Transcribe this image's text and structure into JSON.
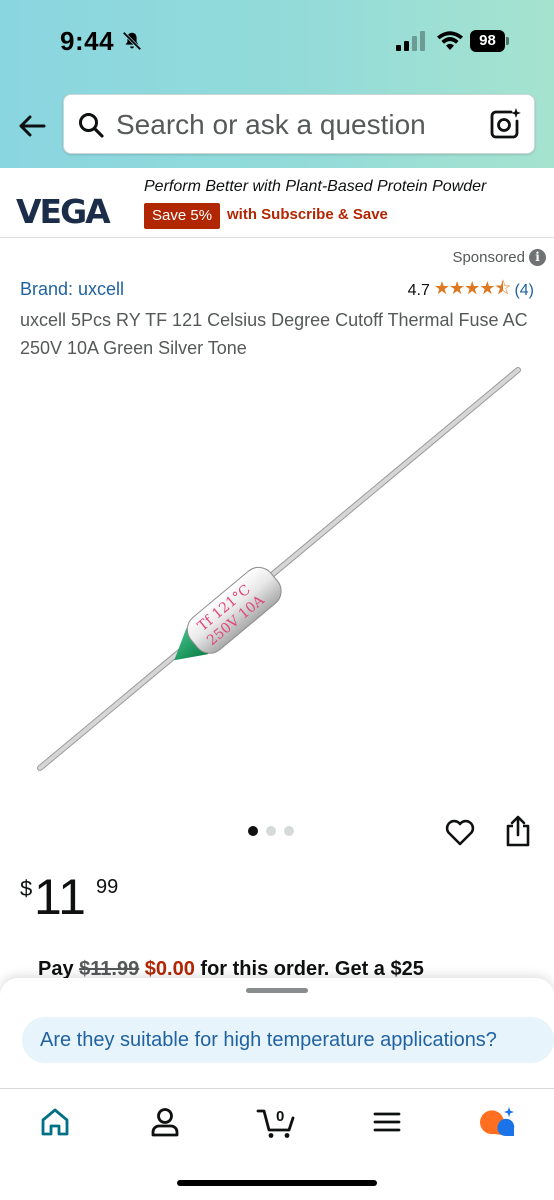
{
  "status_bar": {
    "time": "9:44",
    "battery": "98"
  },
  "header": {
    "search_placeholder": "Search or ask a question",
    "colors": {
      "gradient_start": "#8ad6e0",
      "gradient_end": "#a6e3cf"
    }
  },
  "ad": {
    "logo": "VEGA",
    "headline": "Perform Better with Plant-Based Protein Powder",
    "badge": "Save 5%",
    "sub": "with Subscribe & Save"
  },
  "product": {
    "sponsored": "Sponsored",
    "brand": "Brand: uxcell",
    "rating_value": "4.7",
    "stars": "★★★★⯪",
    "rating_count": "(4)",
    "title": "uxcell 5Pcs RY TF 121 Celsius Degree Cutoff Thermal Fuse AC 250V 10A Green Silver Tone",
    "fuse_text_1": "Tf 121°C",
    "fuse_text_2": "250V 10A",
    "image_count": 3,
    "active_image": 1
  },
  "price": {
    "currency": "$",
    "whole": "11",
    "fraction": "99"
  },
  "pay": {
    "prefix": "Pay",
    "old": "$11.99",
    "new": "$0.00",
    "suffix": "for this order. Get a $25"
  },
  "suggestion": {
    "text": "Are they suitable for high temperature applications?"
  },
  "nav": {
    "cart_count": "0",
    "active_color": "#007185"
  }
}
